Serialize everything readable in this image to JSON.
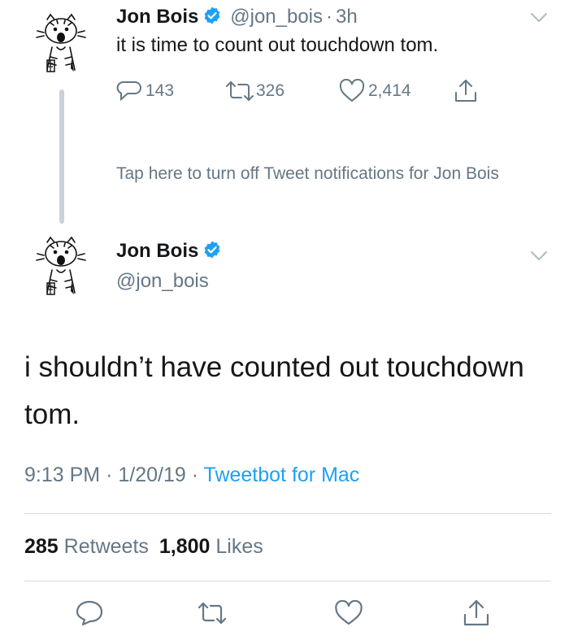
{
  "tweet1": {
    "name": "Jon Bois",
    "handle": "@jon_bois",
    "separator": "·",
    "time": "3h",
    "text": "it is time to count out touchdown tom.",
    "replies": "143",
    "retweets": "326",
    "likes": "2,414"
  },
  "notification": {
    "text": "Tap here to turn off Tweet notifications for Jon Bois"
  },
  "tweet2": {
    "name": "Jon Bois",
    "handle": "@jon_bois",
    "text": "i shouldn’t have counted out touchdown tom.",
    "time": "9:13 PM",
    "sep1": "·",
    "date": "1/20/19",
    "sep2": "·",
    "source": "Tweetbot for Mac",
    "retweet_count": "285",
    "retweet_label": "Retweets",
    "like_count": "1,800",
    "like_label": "Likes"
  },
  "colors": {
    "text": "#14171a",
    "secondary": "#657786",
    "link": "#1da1f2",
    "verified": "#1da1f2",
    "divider": "#d5dbe0",
    "thread_line": "#c9d2d8"
  },
  "icons": {
    "reply": "reply-icon",
    "retweet": "retweet-icon",
    "like": "heart-icon",
    "share": "share-icon",
    "verified": "verified-badge-icon",
    "menu": "chevron-down-icon"
  }
}
